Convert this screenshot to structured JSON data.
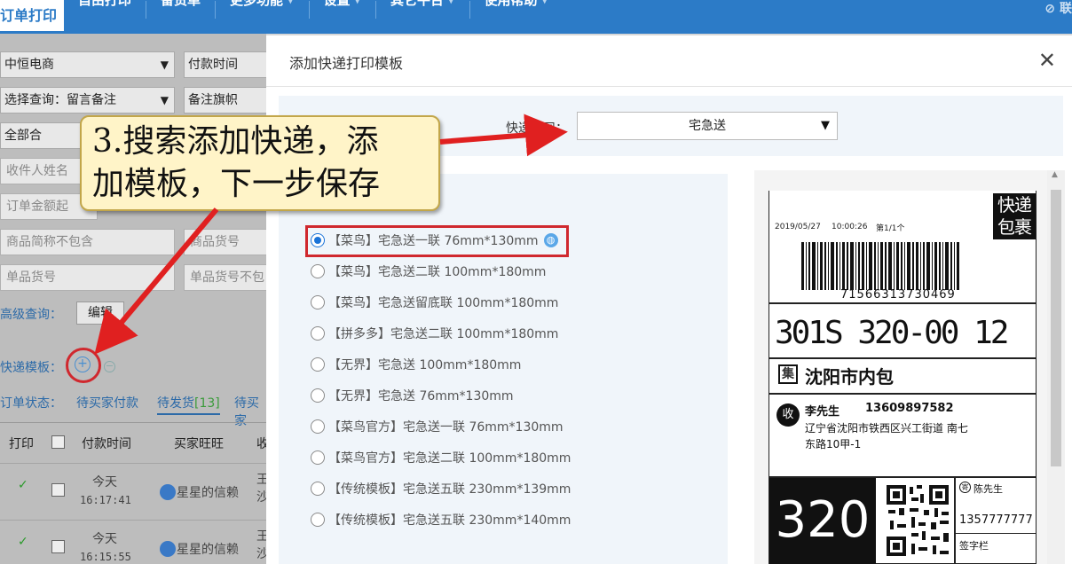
{
  "nav": {
    "active_tab": "订单打印",
    "tabs": [
      "自由打印",
      "备货单",
      "更多功能",
      "设置",
      "其它平台",
      "使用帮助"
    ],
    "right_text": "联"
  },
  "left": {
    "shop_select": "中恒电商",
    "pay_time_label": "付款时间",
    "query_select": "选择查询：留言备注",
    "flag_label": "备注旗帜",
    "all_select": "全部合",
    "receiver_placeholder": "收件人姓名",
    "amount_placeholder": "订单金额起",
    "product_exclude_placeholder": "商品简称不包含",
    "sku_placeholder": "商品货号",
    "item_sku_placeholder": "单品货号",
    "item_sku_not_placeholder": "单品货号不包",
    "advanced_label": "高级查询：",
    "edit_button": "编辑",
    "template_label": "快递模板：",
    "status_label": "订单状态：",
    "status_tabs": [
      "待买家付款",
      "待发货",
      "待买家"
    ],
    "pending_count": "[13]",
    "columns": [
      "打印",
      "付款时间",
      "买家旺旺",
      "收"
    ],
    "rows": [
      {
        "day": "今天",
        "time": "16:17:41",
        "buyer": "星星的信赖",
        "addr": "王沙"
      },
      {
        "day": "今天",
        "time": "16:15:55",
        "buyer": "星星的信赖",
        "addr": "王沙"
      }
    ]
  },
  "modal": {
    "title": "添加快递打印模板",
    "courier_label": "快递公司：",
    "courier_value": "宅急送",
    "options": [
      "【菜鸟】宅急送一联 76mm*130mm",
      "【菜鸟】宅急送二联 100mm*180mm",
      "【菜鸟】宅急送留底联 100mm*180mm",
      "【拼多多】宅急送二联 100mm*180mm",
      "【无界】宅急送 100mm*180mm",
      "【无界】宅急送 76mm*130mm",
      "【菜鸟官方】宅急送一联 76mm*130mm",
      "【菜鸟官方】宅急送二联 100mm*180mm",
      "【传统模板】宅急送五联 230mm*139mm",
      "【传统模板】宅急送五联 230mm*140mm"
    ],
    "selected_index": 0
  },
  "slip": {
    "date": "2019/05/27",
    "time": "10:00:26",
    "page": "第1/1个",
    "badge": "快递包裹",
    "tracking": "71566313730469",
    "sort_code": "301S 320-00 12",
    "collect_tag": "集",
    "collect_point": "沈阳市内包",
    "recv_tag": "收",
    "receiver_name": "李先生",
    "receiver_phone": "13609897582",
    "receiver_addr1": "辽宁省沈阳市铁西区兴工街道 南七",
    "receiver_addr2": "东路10甲-1",
    "big_code": "320",
    "sender": "陈先生",
    "sender_phone": "1357777777",
    "sign_label": "签字栏"
  },
  "callout": {
    "line1": "3.搜索添加快递，添",
    "line2": "加模板，下一步保存"
  },
  "colors": {
    "nav": "#2c7bc7",
    "highlight": "#d0282e",
    "arrow": "#e02020",
    "callout_bg": "#fff4c8"
  }
}
